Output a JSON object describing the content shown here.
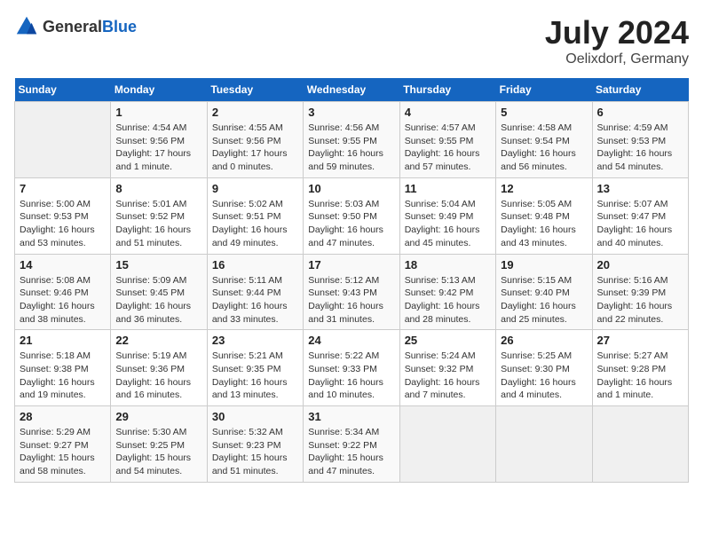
{
  "header": {
    "logo_general": "General",
    "logo_blue": "Blue",
    "month": "July 2024",
    "location": "Oelixdorf, Germany"
  },
  "weekdays": [
    "Sunday",
    "Monday",
    "Tuesday",
    "Wednesday",
    "Thursday",
    "Friday",
    "Saturday"
  ],
  "weeks": [
    [
      {
        "day": "",
        "info": ""
      },
      {
        "day": "1",
        "info": "Sunrise: 4:54 AM\nSunset: 9:56 PM\nDaylight: 17 hours\nand 1 minute."
      },
      {
        "day": "2",
        "info": "Sunrise: 4:55 AM\nSunset: 9:56 PM\nDaylight: 17 hours\nand 0 minutes."
      },
      {
        "day": "3",
        "info": "Sunrise: 4:56 AM\nSunset: 9:55 PM\nDaylight: 16 hours\nand 59 minutes."
      },
      {
        "day": "4",
        "info": "Sunrise: 4:57 AM\nSunset: 9:55 PM\nDaylight: 16 hours\nand 57 minutes."
      },
      {
        "day": "5",
        "info": "Sunrise: 4:58 AM\nSunset: 9:54 PM\nDaylight: 16 hours\nand 56 minutes."
      },
      {
        "day": "6",
        "info": "Sunrise: 4:59 AM\nSunset: 9:53 PM\nDaylight: 16 hours\nand 54 minutes."
      }
    ],
    [
      {
        "day": "7",
        "info": "Sunrise: 5:00 AM\nSunset: 9:53 PM\nDaylight: 16 hours\nand 53 minutes."
      },
      {
        "day": "8",
        "info": "Sunrise: 5:01 AM\nSunset: 9:52 PM\nDaylight: 16 hours\nand 51 minutes."
      },
      {
        "day": "9",
        "info": "Sunrise: 5:02 AM\nSunset: 9:51 PM\nDaylight: 16 hours\nand 49 minutes."
      },
      {
        "day": "10",
        "info": "Sunrise: 5:03 AM\nSunset: 9:50 PM\nDaylight: 16 hours\nand 47 minutes."
      },
      {
        "day": "11",
        "info": "Sunrise: 5:04 AM\nSunset: 9:49 PM\nDaylight: 16 hours\nand 45 minutes."
      },
      {
        "day": "12",
        "info": "Sunrise: 5:05 AM\nSunset: 9:48 PM\nDaylight: 16 hours\nand 43 minutes."
      },
      {
        "day": "13",
        "info": "Sunrise: 5:07 AM\nSunset: 9:47 PM\nDaylight: 16 hours\nand 40 minutes."
      }
    ],
    [
      {
        "day": "14",
        "info": "Sunrise: 5:08 AM\nSunset: 9:46 PM\nDaylight: 16 hours\nand 38 minutes."
      },
      {
        "day": "15",
        "info": "Sunrise: 5:09 AM\nSunset: 9:45 PM\nDaylight: 16 hours\nand 36 minutes."
      },
      {
        "day": "16",
        "info": "Sunrise: 5:11 AM\nSunset: 9:44 PM\nDaylight: 16 hours\nand 33 minutes."
      },
      {
        "day": "17",
        "info": "Sunrise: 5:12 AM\nSunset: 9:43 PM\nDaylight: 16 hours\nand 31 minutes."
      },
      {
        "day": "18",
        "info": "Sunrise: 5:13 AM\nSunset: 9:42 PM\nDaylight: 16 hours\nand 28 minutes."
      },
      {
        "day": "19",
        "info": "Sunrise: 5:15 AM\nSunset: 9:40 PM\nDaylight: 16 hours\nand 25 minutes."
      },
      {
        "day": "20",
        "info": "Sunrise: 5:16 AM\nSunset: 9:39 PM\nDaylight: 16 hours\nand 22 minutes."
      }
    ],
    [
      {
        "day": "21",
        "info": "Sunrise: 5:18 AM\nSunset: 9:38 PM\nDaylight: 16 hours\nand 19 minutes."
      },
      {
        "day": "22",
        "info": "Sunrise: 5:19 AM\nSunset: 9:36 PM\nDaylight: 16 hours\nand 16 minutes."
      },
      {
        "day": "23",
        "info": "Sunrise: 5:21 AM\nSunset: 9:35 PM\nDaylight: 16 hours\nand 13 minutes."
      },
      {
        "day": "24",
        "info": "Sunrise: 5:22 AM\nSunset: 9:33 PM\nDaylight: 16 hours\nand 10 minutes."
      },
      {
        "day": "25",
        "info": "Sunrise: 5:24 AM\nSunset: 9:32 PM\nDaylight: 16 hours\nand 7 minutes."
      },
      {
        "day": "26",
        "info": "Sunrise: 5:25 AM\nSunset: 9:30 PM\nDaylight: 16 hours\nand 4 minutes."
      },
      {
        "day": "27",
        "info": "Sunrise: 5:27 AM\nSunset: 9:28 PM\nDaylight: 16 hours\nand 1 minute."
      }
    ],
    [
      {
        "day": "28",
        "info": "Sunrise: 5:29 AM\nSunset: 9:27 PM\nDaylight: 15 hours\nand 58 minutes."
      },
      {
        "day": "29",
        "info": "Sunrise: 5:30 AM\nSunset: 9:25 PM\nDaylight: 15 hours\nand 54 minutes."
      },
      {
        "day": "30",
        "info": "Sunrise: 5:32 AM\nSunset: 9:23 PM\nDaylight: 15 hours\nand 51 minutes."
      },
      {
        "day": "31",
        "info": "Sunrise: 5:34 AM\nSunset: 9:22 PM\nDaylight: 15 hours\nand 47 minutes."
      },
      {
        "day": "",
        "info": ""
      },
      {
        "day": "",
        "info": ""
      },
      {
        "day": "",
        "info": ""
      }
    ]
  ]
}
